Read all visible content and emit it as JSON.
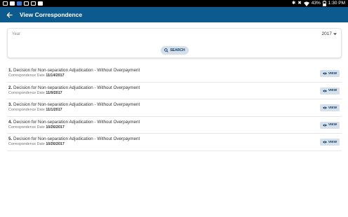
{
  "status_bar": {
    "battery": "43%",
    "time": "1:30 PM",
    "icons_left": [
      "image-icon",
      "news-icon",
      "calendar-icon",
      "tablet-icon",
      "upload-icon",
      "download-icon"
    ],
    "icons_right": [
      "bluetooth-icon",
      "mute-icon",
      "wifi-icon",
      "battery-icon"
    ]
  },
  "app_bar": {
    "title": "View Correspondence",
    "color": "#0d5a8e"
  },
  "search": {
    "year_label": "Year",
    "year_value": "2017",
    "button_label": "SEARCH"
  },
  "correspondence": {
    "date_label": "Correspondence Date",
    "view_label": "VIEW",
    "items": [
      {
        "number": "1.",
        "title": "Decision for Non-separation Adjudication - Without Overpayment",
        "date": "11/14/2017"
      },
      {
        "number": "2.",
        "title": "Decision for Non-separation Adjudication - Without Overpayment",
        "date": "11/9/2017"
      },
      {
        "number": "3.",
        "title": "Decision for Non-separation Adjudication - Without Overpayment",
        "date": "11/1/2017"
      },
      {
        "number": "4.",
        "title": "Decision for Non-separation Adjudication - Without Overpayment",
        "date": "10/26/2017"
      },
      {
        "number": "5.",
        "title": "Decision for Non-separation Adjudication - Without Overpayment",
        "date": "10/26/2017"
      }
    ]
  }
}
